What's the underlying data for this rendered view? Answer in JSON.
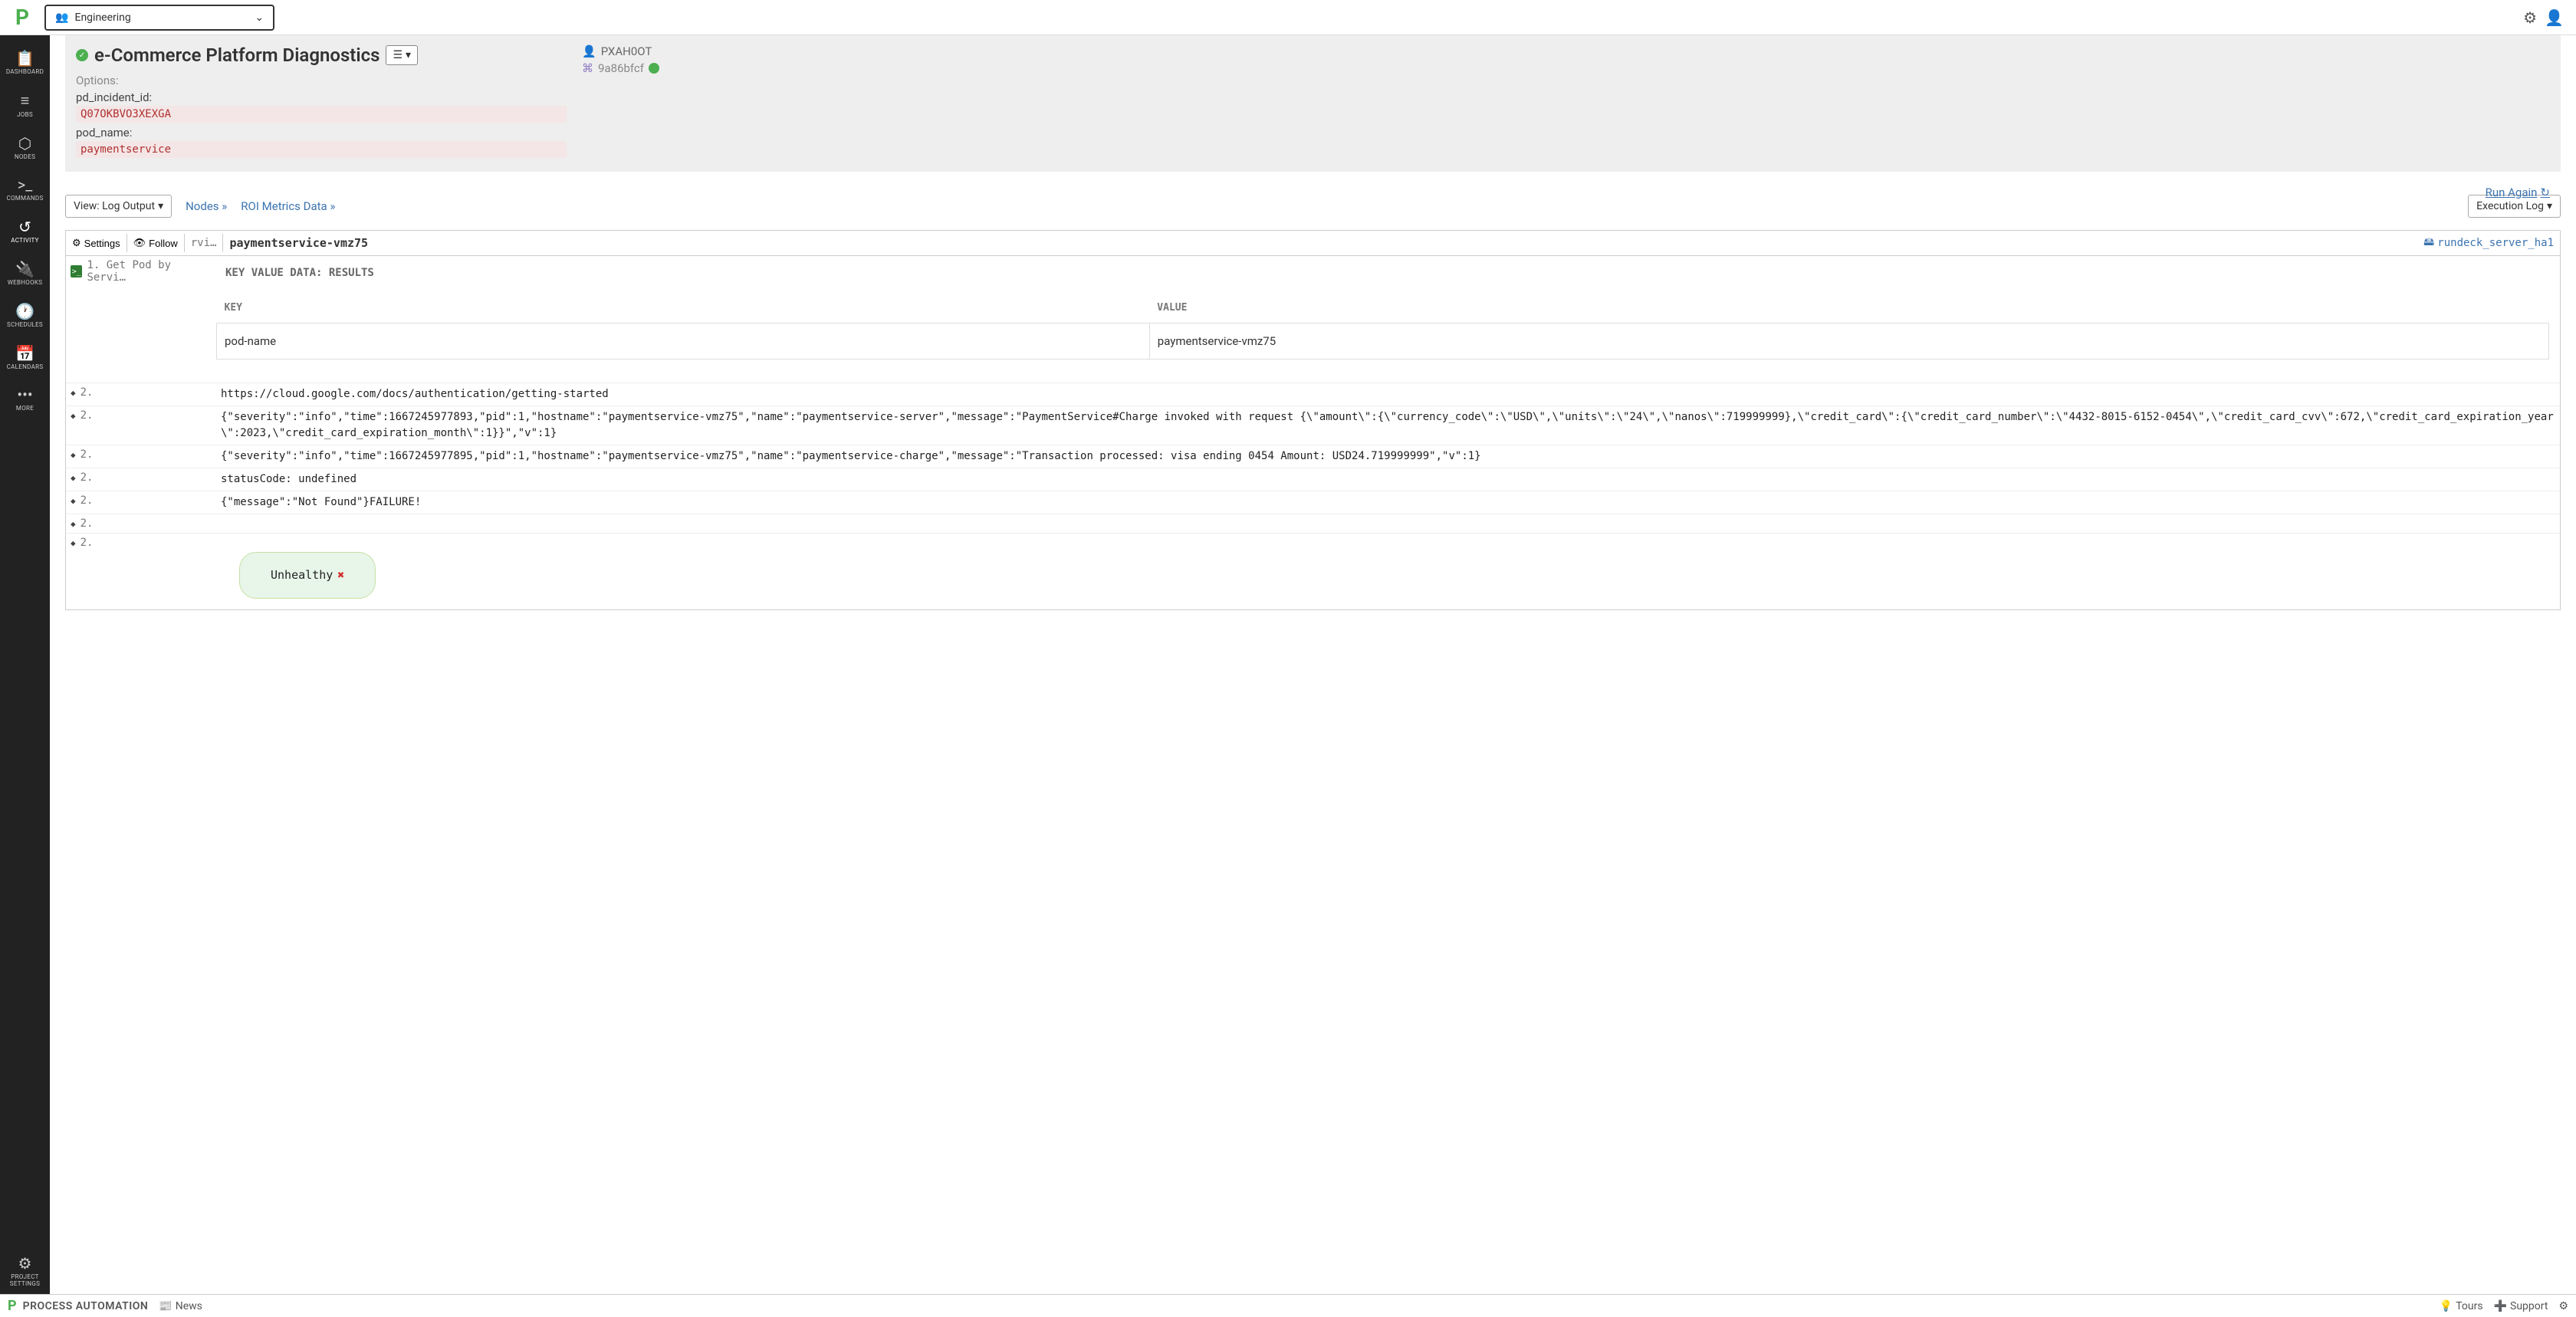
{
  "topbar": {
    "project_name": "Engineering"
  },
  "sidebar": {
    "items": [
      {
        "label": "DASHBOARD",
        "icon": "📋"
      },
      {
        "label": "JOBS",
        "icon": "≡"
      },
      {
        "label": "NODES",
        "icon": "⬡"
      },
      {
        "label": "COMMANDS",
        "icon": ">_"
      },
      {
        "label": "ACTIVITY",
        "icon": "↺"
      },
      {
        "label": "WEBHOOKS",
        "icon": "🔌"
      },
      {
        "label": "SCHEDULES",
        "icon": "🕐"
      },
      {
        "label": "CALENDARS",
        "icon": "📅"
      },
      {
        "label": "MORE",
        "icon": "•••"
      },
      {
        "label": "PROJECT SETTINGS",
        "icon": "⚙"
      }
    ]
  },
  "header": {
    "title": "e-Commerce Platform Diagnostics",
    "options_label": "Options:",
    "options": {
      "pd_incident_id_key": "pd_incident_id:",
      "pd_incident_id_val": "Q07OKBVO3XEXGA",
      "pod_name_key": "pod_name:",
      "pod_name_val": "paymentservice"
    },
    "right": {
      "user": "PXAH0OT",
      "hash": "9a86bfcf",
      "run_again": "Run Again"
    }
  },
  "viewrow": {
    "view_label": "View: Log Output",
    "nodes_link": "Nodes »",
    "roi_link": "ROI Metrics Data »",
    "exec_log": "Execution Log"
  },
  "log_controls": {
    "settings": "Settings",
    "follow": "Follow",
    "info": "rvi…",
    "title_node": "paymentservice-vmz75",
    "server": "rundeck_server_ha1"
  },
  "results": {
    "header": "KEY VALUE DATA: RESULTS",
    "key_col": "KEY",
    "val_col": "VALUE",
    "rows": [
      {
        "key": "pod-name",
        "val": "paymentservice-vmz75"
      }
    ]
  },
  "step1_label": "1. Get Pod by Servi…",
  "log_lines": [
    {
      "n": "2.",
      "text": "https://cloud.google.com/docs/authentication/getting-started"
    },
    {
      "n": "2.",
      "text": "{\"severity\":\"info\",\"time\":1667245977893,\"pid\":1,\"hostname\":\"paymentservice-vmz75\",\"name\":\"paymentservice-server\",\"message\":\"PaymentService#Charge invoked with request {\\\"amount\\\":{\\\"currency_code\\\":\\\"USD\\\",\\\"units\\\":\\\"24\\\",\\\"nanos\\\":719999999},\\\"credit_card\\\":{\\\"credit_card_number\\\":\\\"4432-8015-6152-0454\\\",\\\"credit_card_cvv\\\":672,\\\"credit_card_expiration_year\\\":2023,\\\"credit_card_expiration_month\\\":1}}\",\"v\":1}"
    },
    {
      "n": "2.",
      "text": "{\"severity\":\"info\",\"time\":1667245977895,\"pid\":1,\"hostname\":\"paymentservice-vmz75\",\"name\":\"paymentservice-charge\",\"message\":\"Transaction processed: visa ending 0454     Amount: USD24.719999999\",\"v\":1}"
    },
    {
      "n": "2.",
      "text": "statusCode: undefined"
    },
    {
      "n": "2.",
      "text": "{\"message\":\"Not Found\"}FAILURE!"
    },
    {
      "n": "2.",
      "text": ""
    },
    {
      "n": "2.",
      "text": ""
    }
  ],
  "unhealthy_label": "Unhealthy",
  "footer": {
    "product": "PROCESS AUTOMATION",
    "news": "News",
    "tours": "Tours",
    "support": "Support"
  }
}
